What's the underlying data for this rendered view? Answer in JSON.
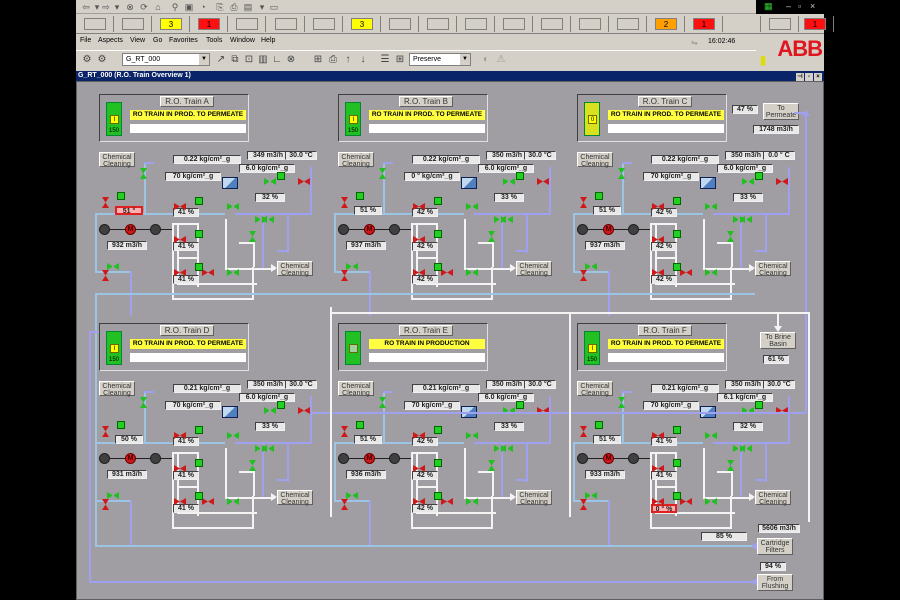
{
  "window": {
    "title": "G_RT_000 (R.O. Train Overview 1)",
    "clock": "16:02:46",
    "logo": "ABB"
  },
  "nav_toolbar": {
    "icons": [
      "back-icon",
      "back-dropdown-icon",
      "forward-icon",
      "forward-dropdown-icon",
      "stop-icon",
      "refresh-icon",
      "home-icon",
      "search-icon",
      "favorites-icon",
      "history-icon",
      "copy-icon",
      "print-icon",
      "document-icon",
      "dropdown-icon",
      "save-icon"
    ]
  },
  "alarm_strip": {
    "boxes": [
      {
        "value": "",
        "color": ""
      },
      {
        "value": "",
        "color": ""
      },
      {
        "value": "3",
        "color": "#ffff00"
      },
      {
        "value": "1",
        "color": "#ff1010"
      },
      {
        "value": "",
        "color": ""
      },
      {
        "value": "",
        "color": ""
      },
      {
        "value": "",
        "color": ""
      },
      {
        "value": "3",
        "color": "#ffff00"
      },
      {
        "value": "",
        "color": ""
      },
      {
        "value": "",
        "color": ""
      },
      {
        "value": "",
        "color": ""
      },
      {
        "value": "",
        "color": ""
      },
      {
        "value": "",
        "color": ""
      },
      {
        "value": "",
        "color": ""
      },
      {
        "value": "",
        "color": ""
      },
      {
        "value": "2",
        "color": "#ffa000"
      },
      {
        "value": "1",
        "color": "#ff1010"
      },
      {
        "value": "",
        "color": "none"
      },
      {
        "value": "",
        "color": ""
      },
      {
        "value": "1",
        "color": "#ff1010"
      }
    ]
  },
  "menu": [
    "File",
    "Aspects",
    "View",
    "Go",
    "Favorites",
    "Tools",
    "Window",
    "Help"
  ],
  "toolbar": {
    "object_combo": "G_RT_000",
    "mode_combo": "Preserve"
  },
  "trains": [
    {
      "id": "A",
      "title": "R.O. Train A",
      "status": "RO TRAIN IN PROD. TO PERMEATE",
      "mode": "I",
      "num": "150",
      "icon_color": "#22c022",
      "dp": "0.22  kg/cm²_g",
      "flow": "349  m3/h",
      "temp": "30.0  °C",
      "pp": "6.0  kg/cm²_g",
      "feed": "70  kg/cm²_g",
      "valve_pct": "51 °",
      "valve_alarm": true,
      "pump_flow": "932  m3/h",
      "stage": [
        "41 %",
        "41 %",
        "41 %"
      ],
      "reject": "32 %"
    },
    {
      "id": "B",
      "title": "R.O. Train B",
      "status": "RO TRAIN IN PROD. TO PERMEATE",
      "mode": "I",
      "num": "150",
      "icon_color": "#22c022",
      "dp": "0.22  kg/cm²_g",
      "flow": "350  m3/h",
      "temp": "30.0  °C",
      "pp": "6.0  kg/cm²_g",
      "feed": "0 ° kg/cm²_g",
      "valve_pct": "51 %",
      "valve_alarm": false,
      "pump_flow": "937  m3/h",
      "stage": [
        "42 %",
        "42 %",
        "42 %"
      ],
      "reject": "33 %"
    },
    {
      "id": "C",
      "title": "R.O. Train C",
      "status": "RO TRAIN IN PROD. TO PERMEATE",
      "mode": "0",
      "num": "",
      "icon_color": "#d8e020",
      "dp": "0.22  kg/cm²_g",
      "flow": "350  m3/h",
      "temp": "0.0 ° C",
      "pp": "6.0  kg/cm²_g",
      "feed": "70  kg/cm²_g",
      "valve_pct": "51 %",
      "valve_alarm": false,
      "pump_flow": "937  m3/h",
      "stage": [
        "42 %",
        "42 %",
        "42 %"
      ],
      "reject": "33 %"
    },
    {
      "id": "D",
      "title": "R.O. Train D",
      "status": "RO TRAIN IN PROD. TO PERMEATE",
      "mode": "I",
      "num": "150",
      "icon_color": "#22c022",
      "dp": "0.21  kg/cm²_g",
      "flow": "350  m3/h",
      "temp": "30.0  °C",
      "pp": "6.0  kg/cm²_g",
      "feed": "70  kg/cm²_g",
      "valve_pct": "50 %",
      "valve_alarm": false,
      "pump_flow": "931  m3/h",
      "stage": [
        "41 %",
        "41 %",
        "41 %"
      ],
      "reject": "33 %"
    },
    {
      "id": "E",
      "title": "R.O. Train E",
      "status": "RO TRAIN IN PRODUCTION",
      "mode": "",
      "num": "",
      "icon_color": "#22c022",
      "dp": "0.21  kg/cm²_g",
      "flow": "350  m3/h",
      "temp": "30.0  °C",
      "pp": "6.0  kg/cm²_g",
      "feed": "70  kg/cm²_g",
      "valve_pct": "51 %",
      "valve_alarm": false,
      "pump_flow": "936  m3/h",
      "stage": [
        "42 %",
        "42 %",
        "42 %"
      ],
      "reject": "33 %"
    },
    {
      "id": "F",
      "title": "R.O. Train F",
      "status": "RO TRAIN IN PROD. TO PERMEATE",
      "mode": "I",
      "num": "150",
      "icon_color": "#22c022",
      "dp": "0.21  kg/cm²_g",
      "flow": "350  m3/h",
      "temp": "30.0  °C",
      "pp": "6.1  kg/cm²_g",
      "feed": "70  kg/cm²_g",
      "valve_pct": "51 %",
      "valve_alarm": false,
      "pump_flow": "933  m3/h",
      "stage": [
        "41 %",
        "41 %",
        "0 ° %"
      ],
      "reject": "32 %"
    }
  ],
  "labels": {
    "chemical_cleaning": "Chemical Cleaning",
    "to_permeate": "To Permeate",
    "to_brine_basin": "To Brine Basin",
    "cartridge_filters": "Cartridge Filters",
    "from_flushing": "From Flushing"
  },
  "plant": {
    "permeate_pct": "47 %",
    "permeate_flow": "1748  m3/h",
    "brine_pct": "61 %",
    "total_flow": "5606  m3/h",
    "cartridge_pct": "85 %",
    "flushing_pct": "94 %"
  }
}
